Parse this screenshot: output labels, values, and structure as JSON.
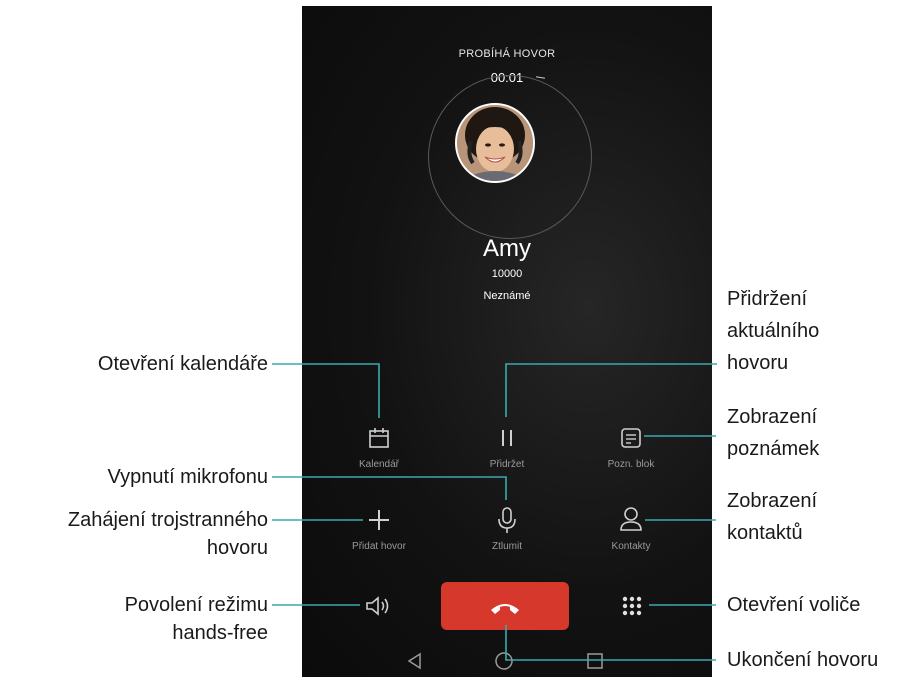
{
  "call": {
    "status": "PROBÍHÁ HOVOR",
    "timer": "00:01",
    "contact_name": "Amy",
    "contact_number": "10000",
    "contact_status": "Neznámé"
  },
  "controls": {
    "calendar": "Kalendář",
    "hold": "Přidržet",
    "notepad": "Pozn. blok",
    "add_call": "Přidat hovor",
    "mute": "Ztlumit",
    "contacts": "Kontakty"
  },
  "annotations": {
    "open_calendar": "Otevření kalendáře",
    "hold_line1": "Přidržení",
    "hold_line2": "aktuálního",
    "hold_line3": "hovoru",
    "notes_line1": "Zobrazení",
    "notes_line2": "poznámek",
    "mute": "Vypnutí mikrofonu",
    "three_way_line1": "Zahájení trojstranného",
    "three_way_line2": "hovoru",
    "contacts_line1": "Zobrazení",
    "contacts_line2": "kontaktů",
    "speaker_line1": "Povolení režimu",
    "speaker_line2": "hands-free",
    "dialpad": "Otevření voliče",
    "end_call": "Ukončení hovoru"
  },
  "colors": {
    "end_call": "#d6392c",
    "leader_line": "#3aaab0",
    "screen_bg": "#121212"
  },
  "icons": [
    "calendar-icon",
    "pause-icon",
    "notepad-icon",
    "microphone-icon",
    "plus-icon",
    "person-icon",
    "speaker-icon",
    "end-call-icon",
    "dialpad-icon",
    "back-icon",
    "home-icon",
    "recents-icon"
  ]
}
